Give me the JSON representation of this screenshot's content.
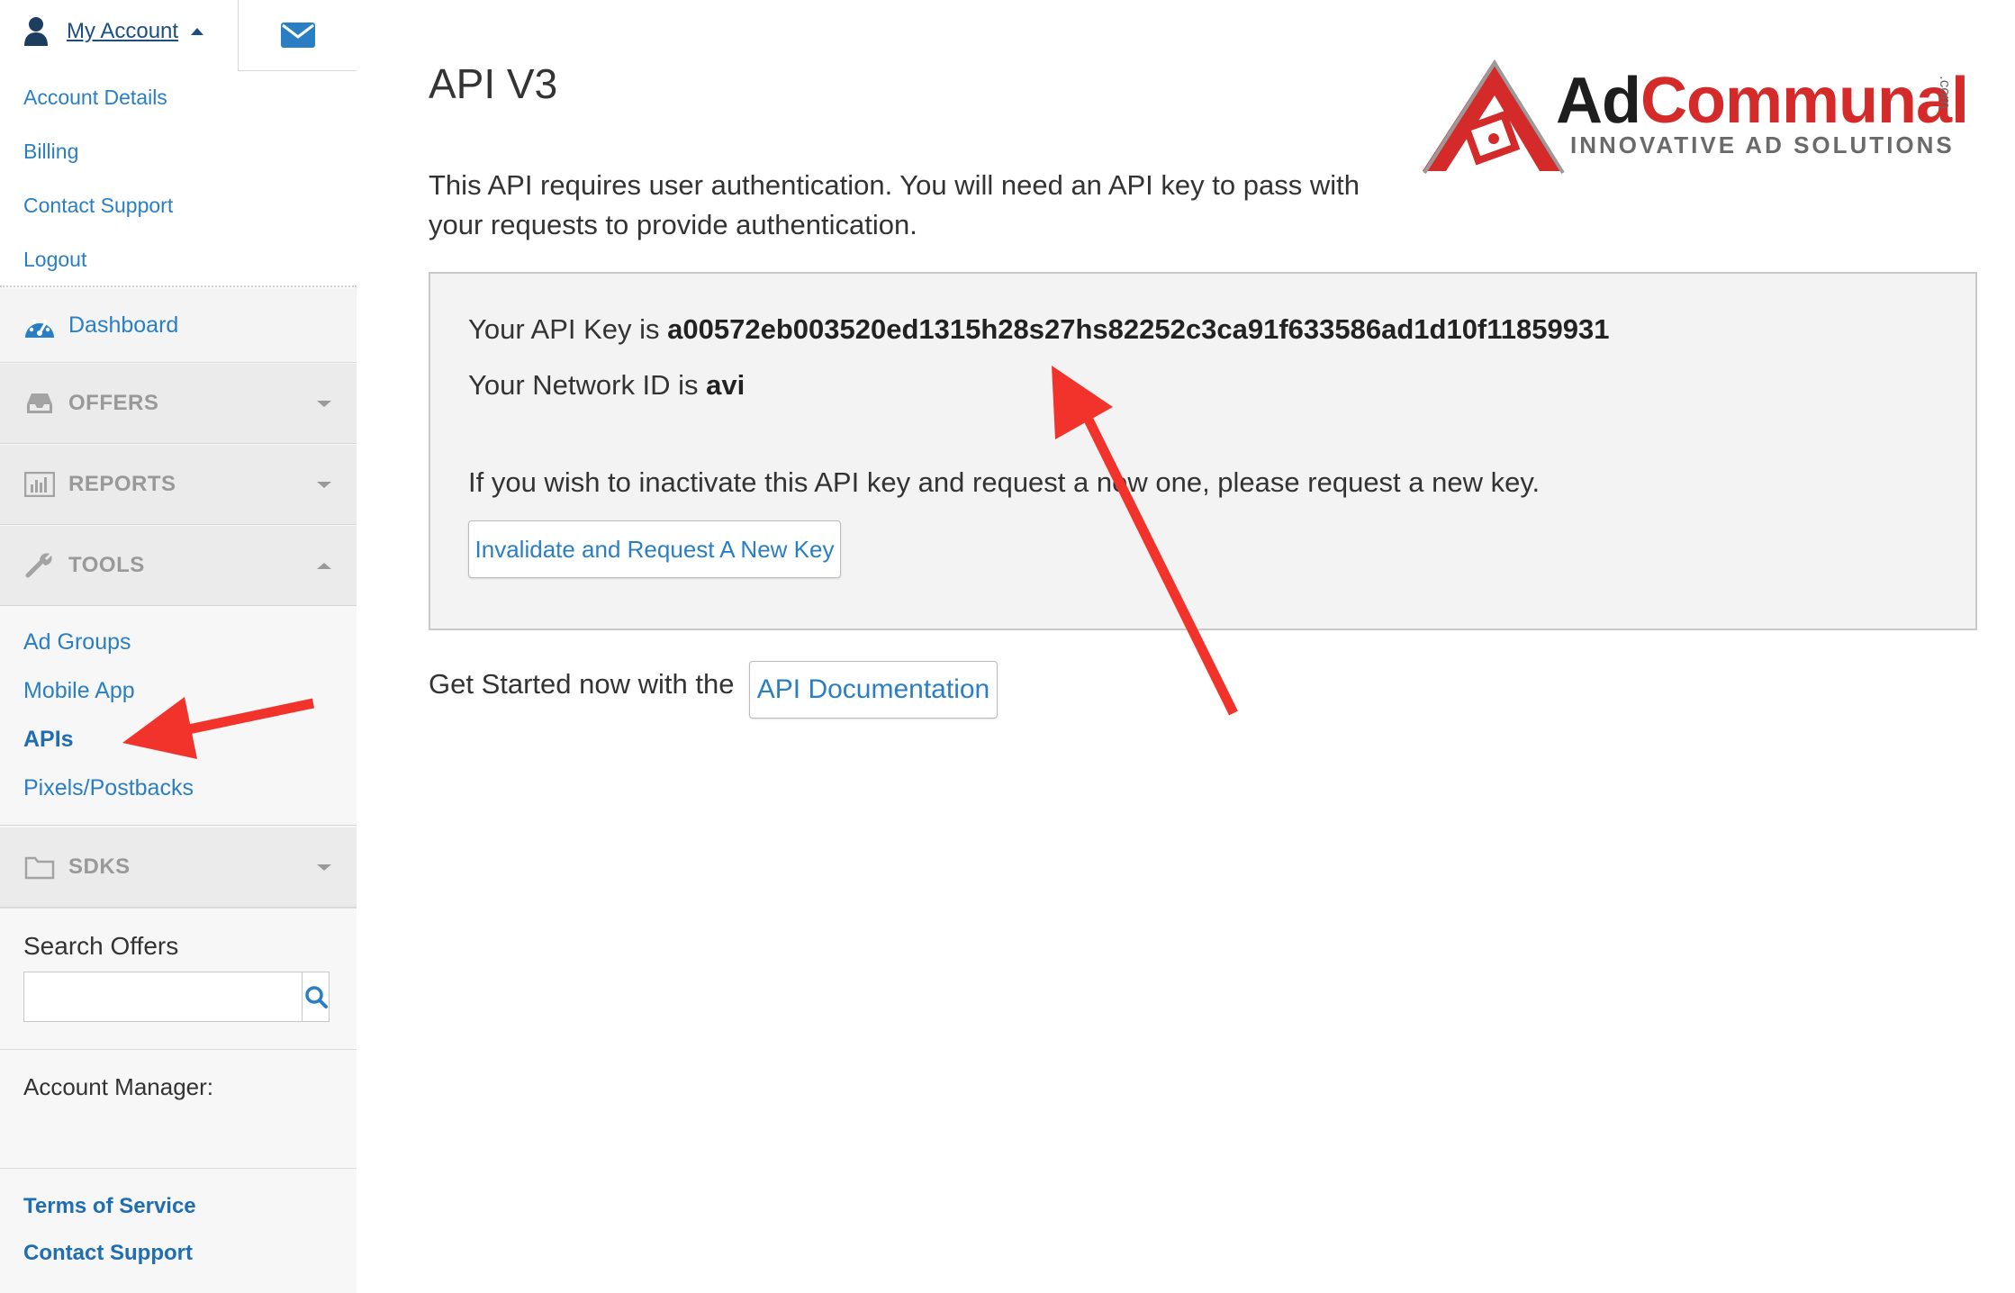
{
  "sidebar": {
    "account_label": "My Account",
    "account_menu": [
      "Account Details",
      "Billing",
      "Contact Support",
      "Logout"
    ],
    "dashboard_label": "Dashboard",
    "sections": {
      "offers": "OFFERS",
      "reports": "REPORTS",
      "tools": "TOOLS",
      "sdks": "SDKS"
    },
    "tools_items": [
      "Ad Groups",
      "Mobile App",
      "APIs",
      "Pixels/Postbacks"
    ],
    "active_item": "APIs",
    "search_title": "Search Offers",
    "search_value": "",
    "account_manager_label": "Account Manager:",
    "footer_links": [
      "Terms of Service",
      "Contact Support"
    ]
  },
  "main": {
    "title": "API V3",
    "intro": "This API requires user authentication. You will need an API key to pass with your requests to provide authentication.",
    "api_key_prefix": "Your API Key is ",
    "api_key": "a00572eb003520ed1315h28s27hs82252c3ca91f633586ad1d10f11859931",
    "network_prefix": "Your Network ID is ",
    "network_id": "avi",
    "invalidate_text": "If you wish to inactivate this API key and request a new one, please request a new key.",
    "invalidate_button": "Invalidate and Request A New Key",
    "get_started": "Get Started now with the",
    "doc_button": "API Documentation"
  },
  "logo": {
    "ad": "Ad",
    "communal": "Communal",
    "dotcom": ".com",
    "tagline": "INNOVATIVE AD SOLUTIONS"
  },
  "colors": {
    "link": "#2a7fc4",
    "annotation_arrow": "#f2332b",
    "brand_red": "#d42a2a"
  },
  "icons": [
    "user-icon",
    "envelope-icon",
    "dashboard-gauge-icon",
    "inbox-icon",
    "bar-chart-icon",
    "wrench-icon",
    "folder-icon",
    "search-icon"
  ]
}
